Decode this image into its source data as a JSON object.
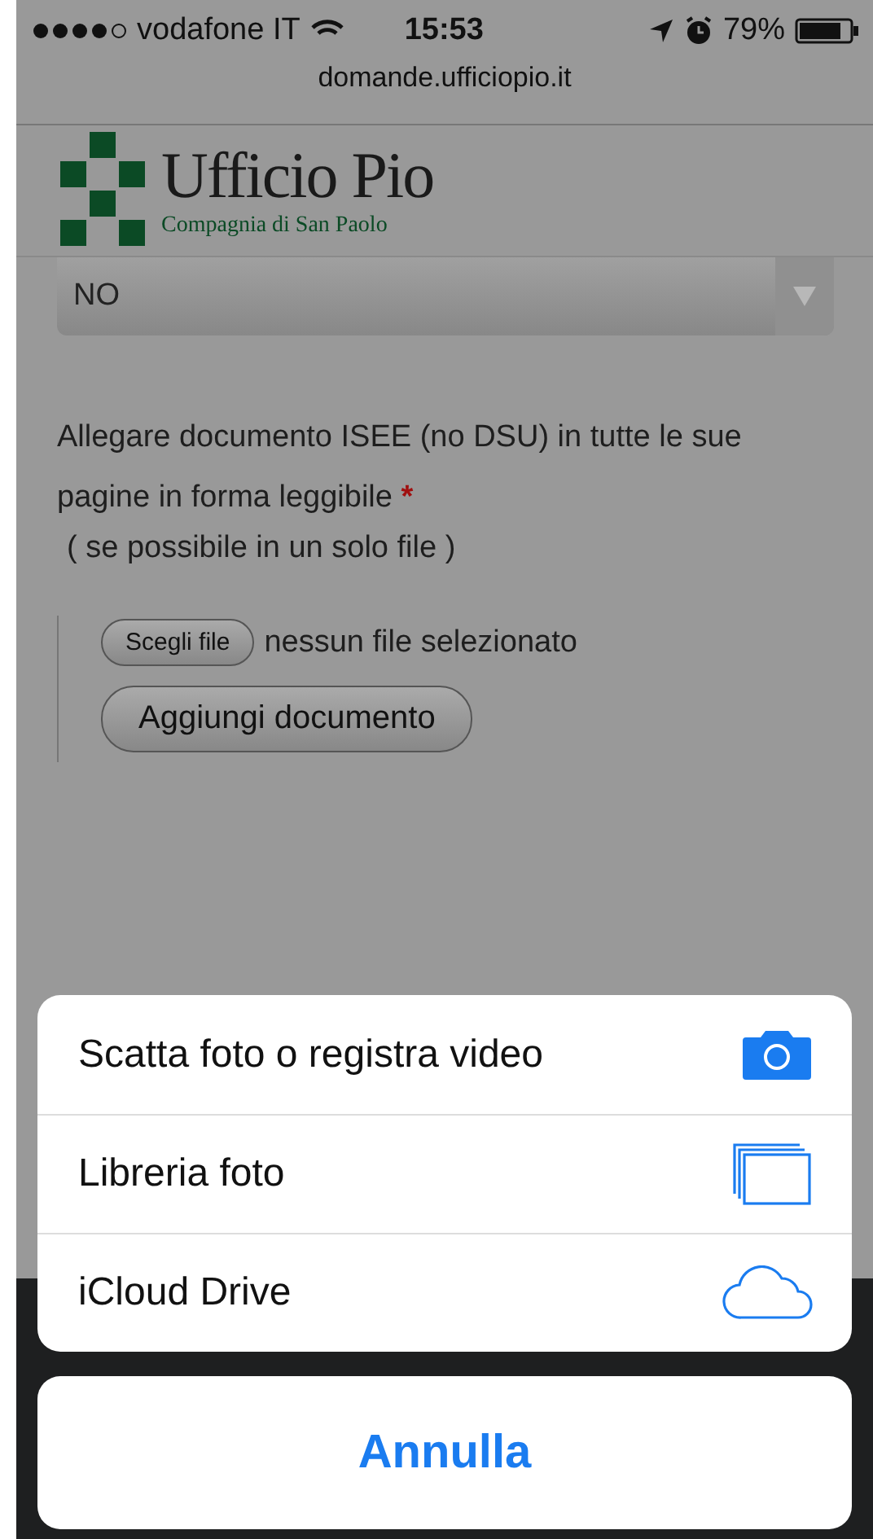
{
  "status_bar": {
    "carrier": "vodafone IT",
    "time": "15:53",
    "battery": "79%"
  },
  "address_bar": {
    "url": "domande.ufficiopio.it"
  },
  "logo": {
    "title": "Ufficio Pio",
    "subtitle": "Compagnia di San Paolo"
  },
  "select": {
    "value": "NO"
  },
  "attachment": {
    "label": "Allegare documento ISEE (no DSU) in tutte le sue pagine in forma leggibile",
    "required_mark": "*",
    "note": "( se possibile in un solo file )",
    "file_button": "Scegli file",
    "file_status": "nessun file selezionato",
    "add_button": "Aggiungi documento"
  },
  "action_sheet": {
    "items": [
      {
        "label": "Scatta foto o registra video",
        "kind": "camera"
      },
      {
        "label": "Libreria foto",
        "kind": "library"
      },
      {
        "label": "iCloud Drive",
        "kind": "cloud"
      }
    ],
    "cancel": "Annulla"
  }
}
